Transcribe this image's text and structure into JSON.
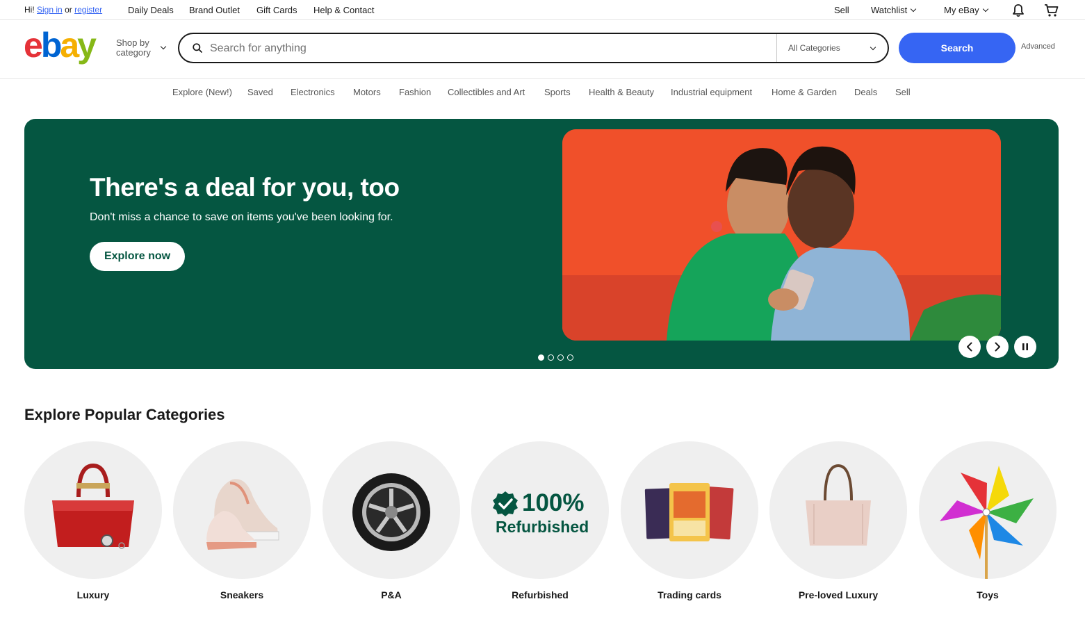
{
  "topbar": {
    "greeting_prefix": "Hi!",
    "sign_in": "Sign in",
    "or": "or",
    "register": "register",
    "links": [
      "Daily Deals",
      "Brand Outlet",
      "Gift Cards",
      "Help & Contact"
    ],
    "sell": "Sell",
    "watchlist": "Watchlist",
    "my_ebay": "My eBay"
  },
  "header": {
    "logo": {
      "e": "e",
      "b": "b",
      "a": "a",
      "y": "y"
    },
    "shop_by_line1": "Shop by",
    "shop_by_line2": "category",
    "search_placeholder": "Search for anything",
    "category_select": "All Categories",
    "search_button": "Search",
    "advanced": "Advanced"
  },
  "nav": {
    "items": [
      "Explore (New!)",
      "Saved",
      "Electronics",
      "Motors",
      "Fashion",
      "Collectibles and Art",
      "Sports",
      "Health & Beauty",
      "Industrial equipment",
      "Home & Garden",
      "Deals",
      "Sell"
    ]
  },
  "hero": {
    "title": "There's a deal for you, too",
    "subtitle": "Don't miss a chance to save on items you've been looking for.",
    "button": "Explore now",
    "slide_count": 4,
    "active_slide": 1,
    "colors": {
      "background": "#055641",
      "image_bg": "#f0502a"
    }
  },
  "categories": {
    "title": "Explore Popular Categories",
    "items": [
      {
        "label": "Luxury",
        "icon": "handbag-icon"
      },
      {
        "label": "Sneakers",
        "icon": "sneaker-icon"
      },
      {
        "label": "P&A",
        "icon": "wheel-icon"
      },
      {
        "label": "Refurbished",
        "icon": "refurbished-badge-icon",
        "badge_percent": "100%",
        "badge_word": "Refurbished"
      },
      {
        "label": "Trading cards",
        "icon": "trading-cards-icon"
      },
      {
        "label": "Pre-loved Luxury",
        "icon": "tote-bag-icon"
      },
      {
        "label": "Toys",
        "icon": "pinwheel-icon"
      }
    ]
  },
  "colors": {
    "accent": "#3665f3",
    "brand_green": "#055641"
  }
}
